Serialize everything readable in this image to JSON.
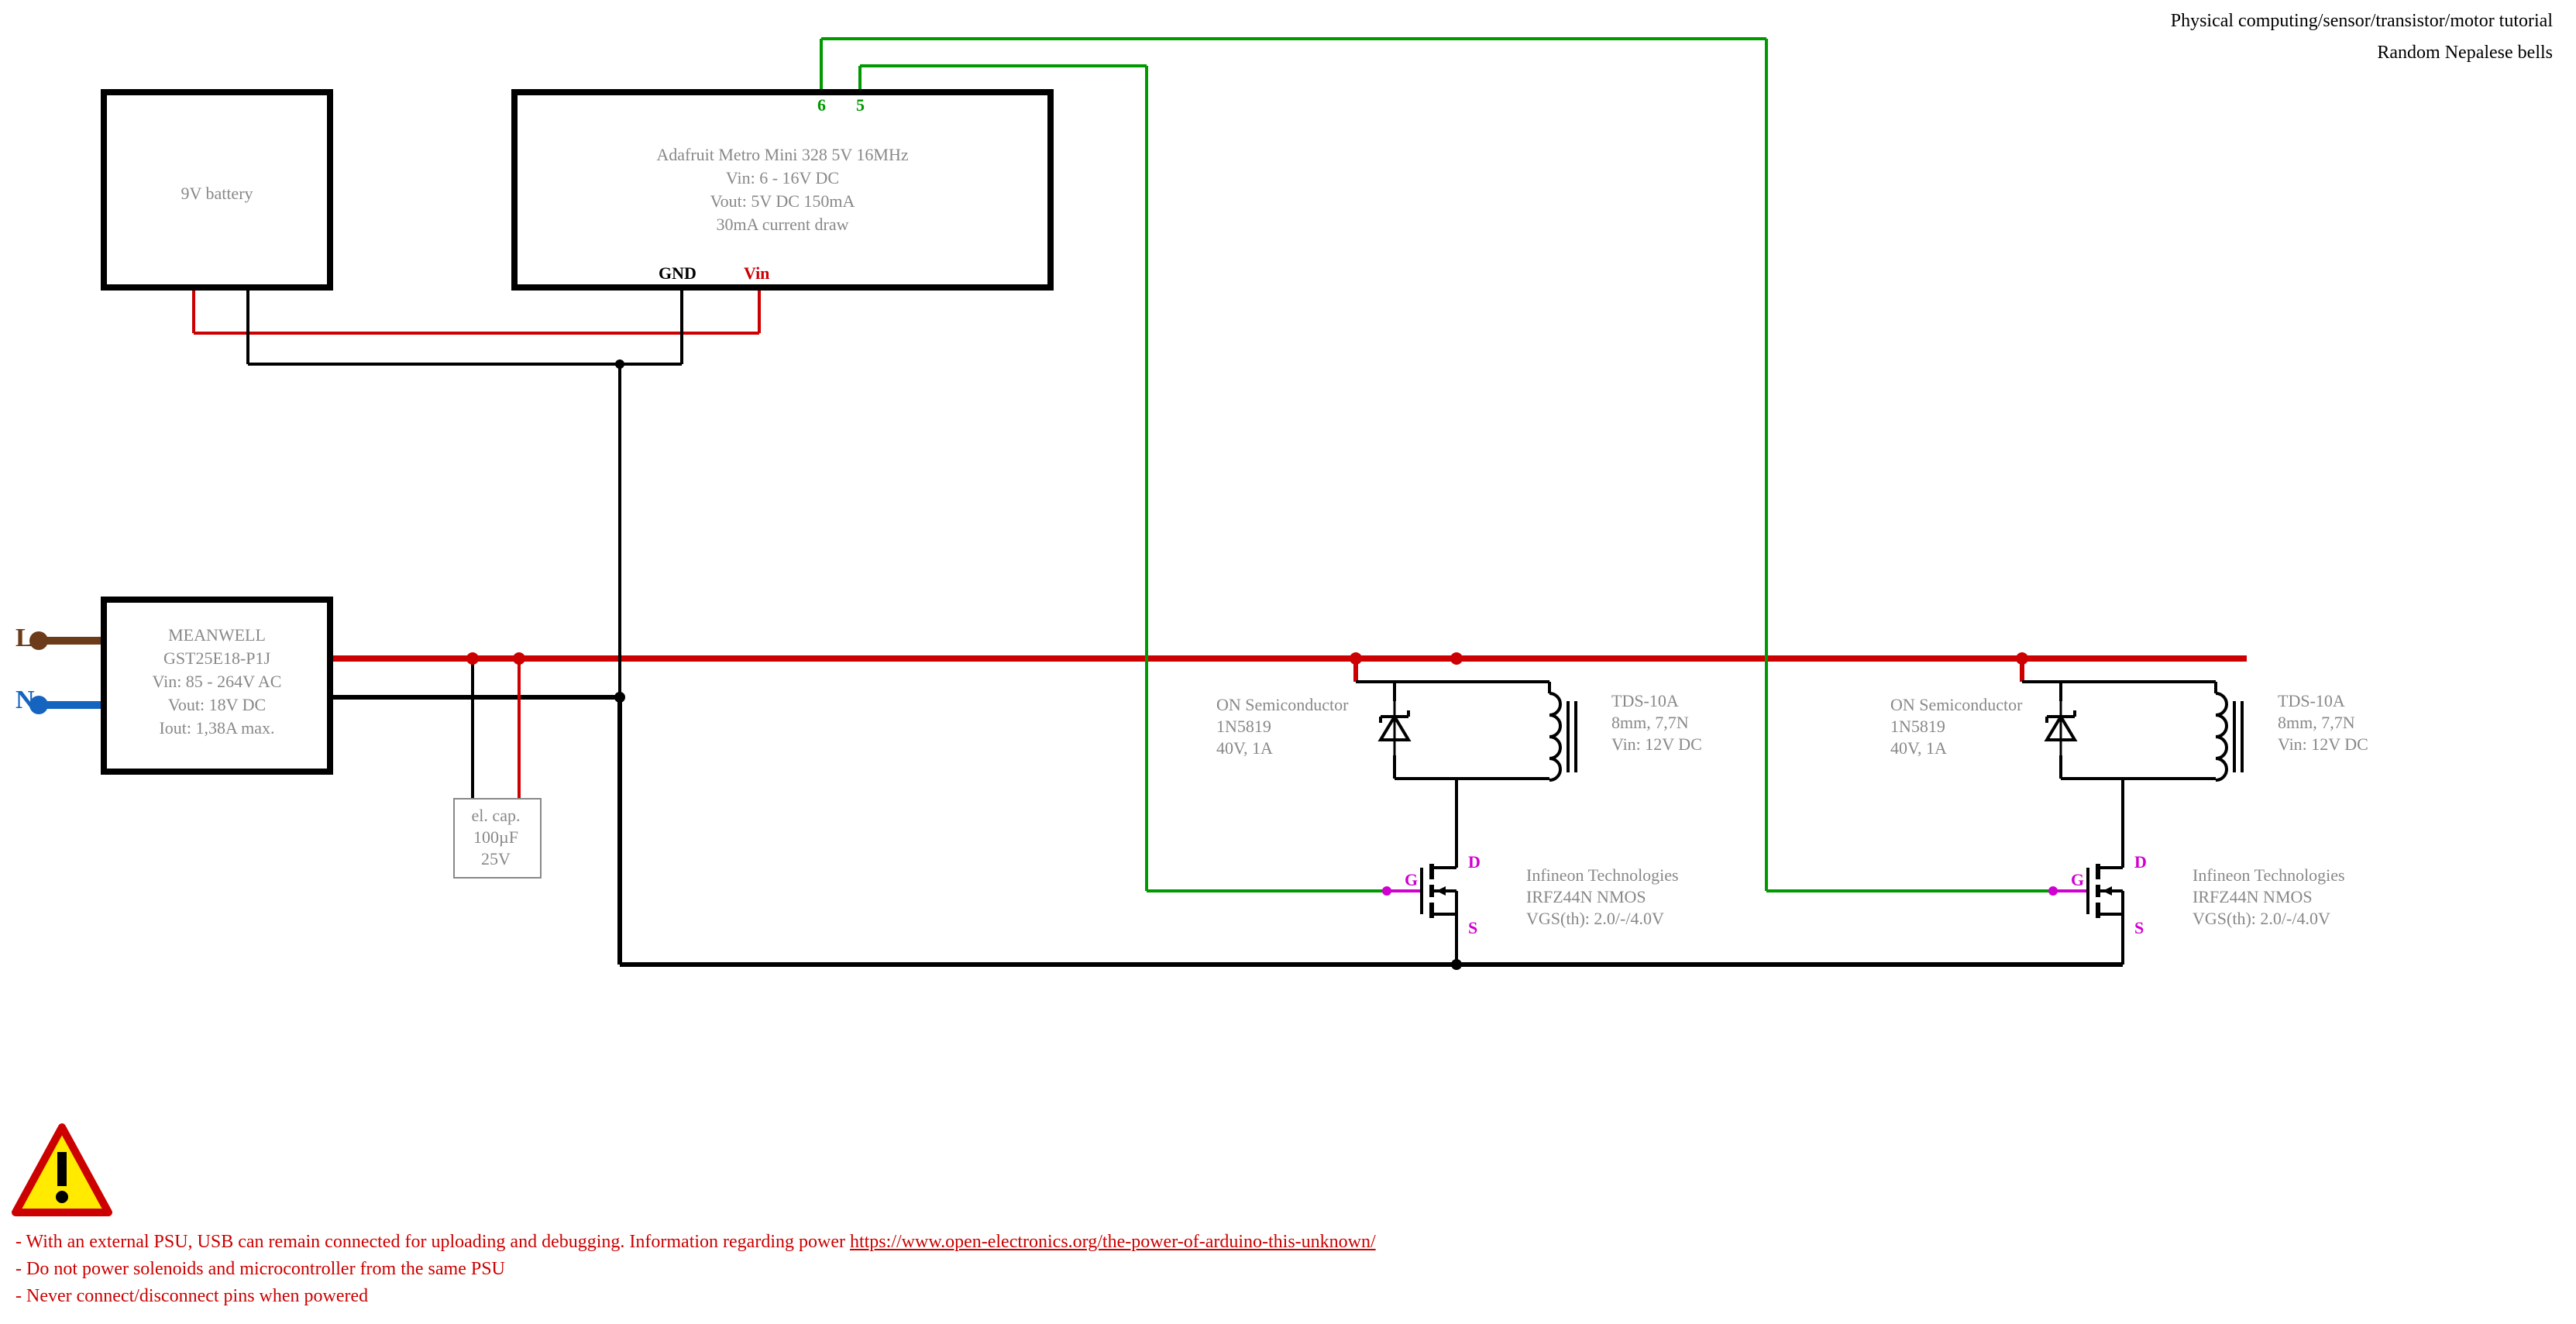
{
  "header": {
    "line1": "Physical computing/sensor/transistor/motor tutorial",
    "line2": "Random Nepalese bells"
  },
  "battery": {
    "label": "9V battery"
  },
  "mcu": {
    "line1": "Adafruit Metro Mini 328 5V 16MHz",
    "line2": "Vin: 6 - 16V DC",
    "line3": "Vout: 5V DC 150mA",
    "line4": "30mA current draw",
    "pin_gnd": "GND",
    "pin_vin": "Vin",
    "pin6": "6",
    "pin5": "5"
  },
  "psu": {
    "line1": "MEANWELL",
    "line2": "GST25E18-P1J",
    "line3": "Vin: 85 - 264V AC",
    "line4": "Vout: 18V DC",
    "line5": "Iout: 1,38A max."
  },
  "mains": {
    "L": "L",
    "N": "N"
  },
  "cap": {
    "line1": "el. cap.",
    "line2": "100µF",
    "line3": "25V"
  },
  "diode": {
    "line1": "ON Semiconductor",
    "line2": "1N5819",
    "line3": "40V, 1A"
  },
  "solenoid": {
    "line1": "TDS-10A",
    "line2": "8mm, 7,7N",
    "line3": "Vin: 12V DC"
  },
  "mosfet": {
    "line1": "Infineon Technologies",
    "line2": "IRFZ44N NMOS",
    "line3": "VGS(th): 2.0/-/4.0V",
    "G": "G",
    "D": "D",
    "S": "S"
  },
  "warnings": {
    "l1_pre": "- With an external PSU, USB can remain connected for uploading and debugging. Information regarding power ",
    "l1_link": "https://www.open-electronics.org/the-power-of-arduino-this-unknown/",
    "l2": "- Do not power solenoids and microcontroller from the same PSU",
    "l3": "- Never connect/disconnect pins when powered"
  }
}
